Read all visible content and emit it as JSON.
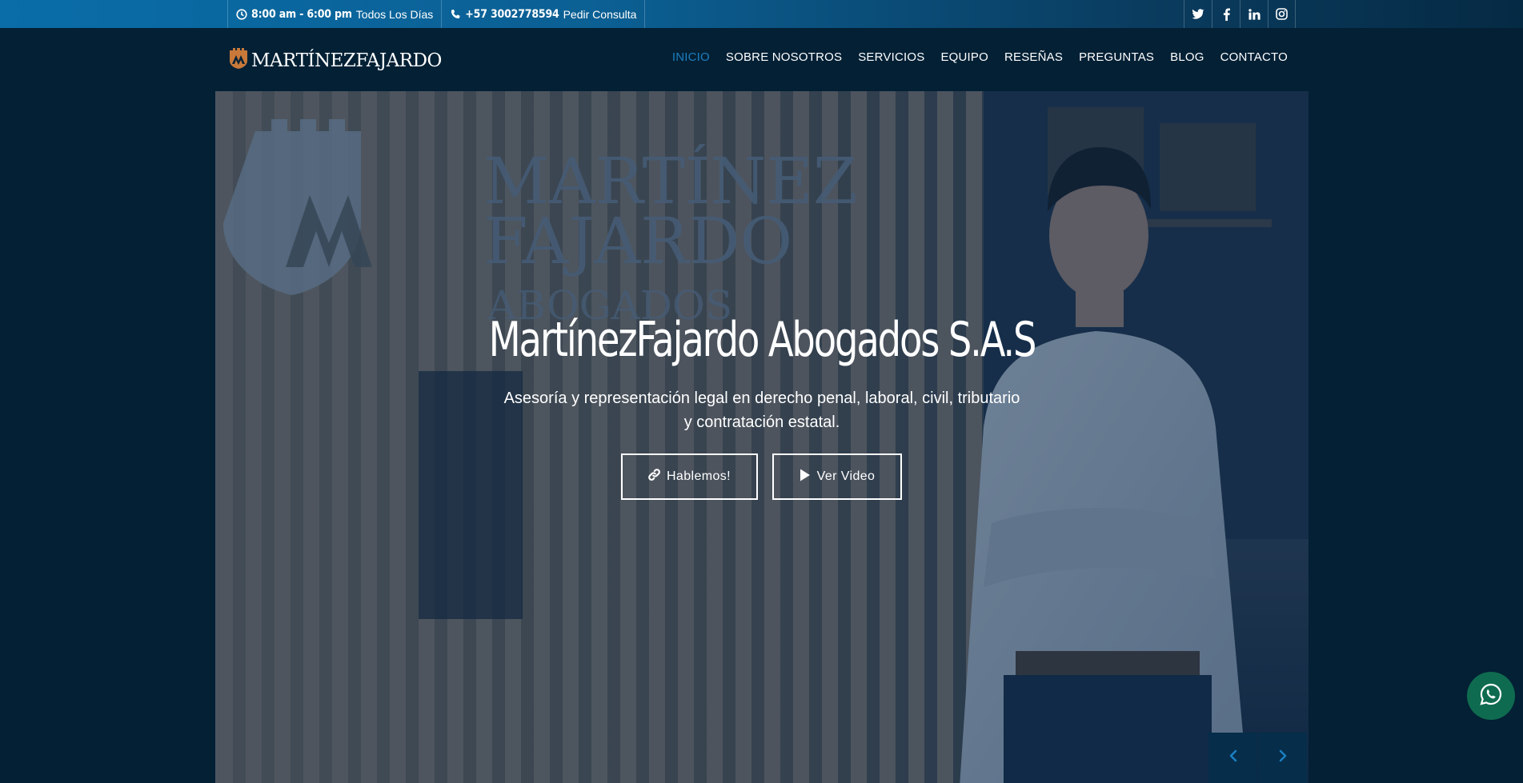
{
  "topbar": {
    "hours_time": "8:00 am - 6:00 pm",
    "hours_days": "Todos Los Días",
    "phone_number": "+57 3002778594",
    "phone_cta": "Pedir Consulta",
    "social_icons": [
      "twitter-icon",
      "facebook-icon",
      "linkedin-icon",
      "instagram-icon"
    ]
  },
  "header": {
    "logo_text": "MARTÍNEZFAJARDO",
    "nav": [
      {
        "label": "INICIO",
        "active": true
      },
      {
        "label": "SOBRE NOSOTROS"
      },
      {
        "label": "SERVICIOS"
      },
      {
        "label": "EQUIPO"
      },
      {
        "label": "RESEÑAS"
      },
      {
        "label": "PREGUNTAS"
      },
      {
        "label": "BLOG"
      },
      {
        "label": "CONTACTO"
      }
    ]
  },
  "hero": {
    "title": "MartínezFajardo Abogados S.A.S",
    "subtitle": "Asesoría y representación legal en derecho penal, laboral, civil, tributario y contratación estatal.",
    "btn_primary": "Hablemos!",
    "btn_secondary": "Ver Video",
    "wall_sign": "MARTÍNEZ FAJARDO ABOGADOS"
  },
  "colors": {
    "accent": "#1b7fc0",
    "page_bg": "#032035",
    "whatsapp": "#0f6b4f"
  }
}
